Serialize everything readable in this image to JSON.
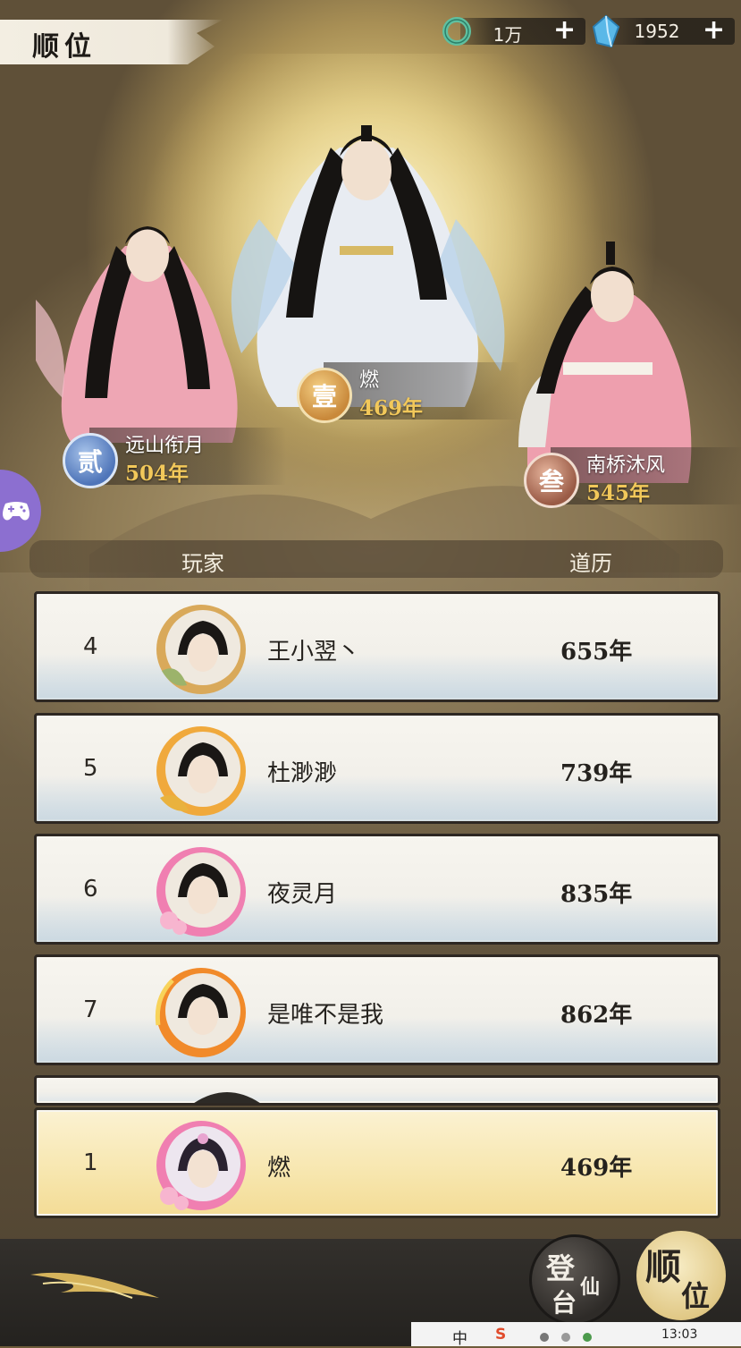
{
  "title": "顺位",
  "currency": [
    {
      "icon": "jade-ring-icon",
      "value": "1万",
      "plus": "+"
    },
    {
      "icon": "spirit-crystal-icon",
      "value": "1952",
      "plus": "+"
    }
  ],
  "podium": {
    "first": {
      "rank_glyph": "壹",
      "name": "燃",
      "score": "469年"
    },
    "second": {
      "rank_glyph": "贰",
      "name": "远山衔月",
      "score": "504年"
    },
    "third": {
      "rank_glyph": "叁",
      "name": "南桥沐风",
      "score": "545年"
    }
  },
  "list_header": {
    "player": "玩家",
    "score": "道历"
  },
  "rows": [
    {
      "rank": "4",
      "name": "王小翌丶",
      "score": "655年"
    },
    {
      "rank": "5",
      "name": "杜渺渺",
      "score": "739年"
    },
    {
      "rank": "6",
      "name": "夜灵月",
      "score": "835年"
    },
    {
      "rank": "7",
      "name": "是唯不是我",
      "score": "862年"
    }
  ],
  "my_row": {
    "rank": "1",
    "name": "燃",
    "score": "469年"
  },
  "bottom": {
    "stage_button": {
      "c1": "登",
      "c2": "仙",
      "c3": "台"
    },
    "rank_button": {
      "c1": "顺",
      "c2": "位"
    }
  },
  "system_bar": {
    "ime": "中",
    "sogou": "S",
    "time": "13:03"
  },
  "colors": {
    "gold_score": "#f2c85a",
    "my_row_bg": "#f7e6ae",
    "row_bg": "#f3f1eb"
  }
}
